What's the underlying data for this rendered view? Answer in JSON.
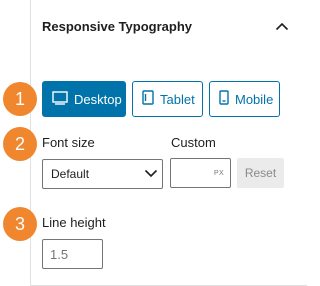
{
  "panel": {
    "title": "Responsive Typography",
    "toggle_icon": "chevron-up-icon"
  },
  "steps": [
    "1",
    "2",
    "3"
  ],
  "devices": [
    {
      "label": "Desktop",
      "icon": "desktop-icon",
      "active": true
    },
    {
      "label": "Tablet",
      "icon": "tablet-icon",
      "active": false
    },
    {
      "label": "Mobile",
      "icon": "mobile-icon",
      "active": false
    }
  ],
  "font_size": {
    "label": "Font size",
    "selected": "Default",
    "custom_label": "Custom",
    "custom_value": "",
    "unit": "PX",
    "reset_label": "Reset"
  },
  "line_height": {
    "label": "Line height",
    "placeholder": "1.5"
  },
  "colors": {
    "accent": "#0073aa",
    "step_badge": "#f0862e"
  }
}
